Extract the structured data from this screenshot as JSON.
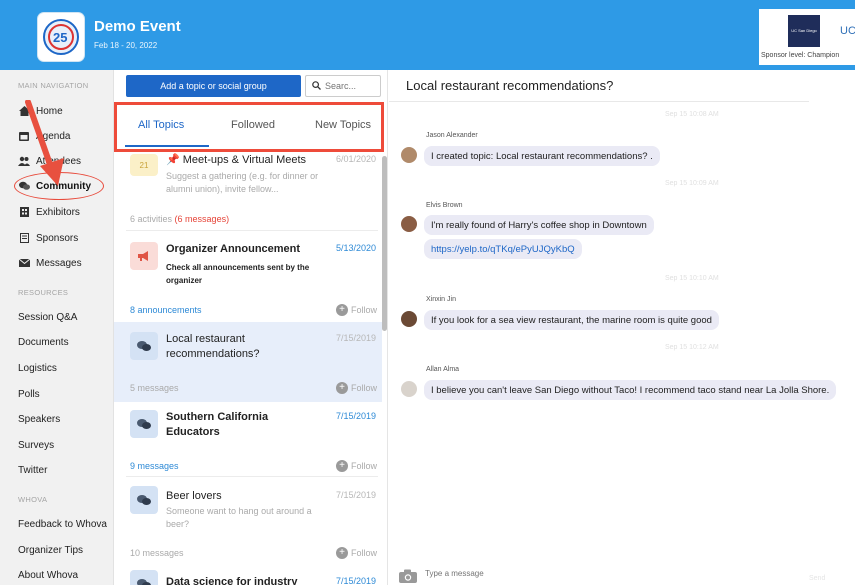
{
  "header": {
    "event_title": "Demo Event",
    "event_dates": "Feb 18 - 20, 2022",
    "sponsor_logo_text": "UC San Diego",
    "sponsor_abbr": "UC",
    "sponsor_level": "Sponsor level: Champion"
  },
  "sidebar": {
    "main_nav_title": "MAIN NAVIGATION",
    "main_items": [
      {
        "label": "Home",
        "icon": "home-icon"
      },
      {
        "label": "Agenda",
        "icon": "calendar-icon"
      },
      {
        "label": "Attendees",
        "icon": "people-icon"
      },
      {
        "label": "Community",
        "icon": "community-icon"
      },
      {
        "label": "Exhibitors",
        "icon": "building-icon"
      },
      {
        "label": "Sponsors",
        "icon": "sponsor-icon"
      },
      {
        "label": "Messages",
        "icon": "envelope-icon"
      }
    ],
    "active_item": "Community",
    "resources_title": "RESOURCES",
    "resource_items": [
      "Session Q&A",
      "Documents",
      "Logistics",
      "Polls",
      "Speakers",
      "Surveys",
      "Twitter"
    ],
    "whova_title": "WHOVA",
    "whova_items": [
      "Feedback to Whova",
      "Organizer Tips",
      "About Whova"
    ]
  },
  "topics": {
    "add_button": "Add a topic or social group",
    "search_placeholder": "Searc...",
    "tabs": [
      "All Topics",
      "Followed",
      "New Topics"
    ],
    "active_tab": "All Topics",
    "follow_label": "Follow",
    "items": [
      {
        "title": "Meet-ups & Virtual Meets",
        "date": "6/01/2020",
        "desc": "Suggest a gathering (e.g. for dinner or alumni union), invite fellow...",
        "meta": "6 activities",
        "meta_extra": "(6 messages)",
        "icon": "pin-icon"
      },
      {
        "title": "Organizer Announcement",
        "date": "5/13/2020",
        "desc": "Check all announcements sent by the organizer",
        "meta": "8 announcements",
        "icon": "megaphone-icon"
      },
      {
        "title": "Local restaurant recommendations?",
        "date": "7/15/2019",
        "meta": "5 messages",
        "icon": "chat-icon"
      },
      {
        "title": "Southern California Educators",
        "date": "7/15/2019",
        "meta": "9 messages",
        "icon": "chat-icon"
      },
      {
        "title": "Beer lovers",
        "date": "7/15/2019",
        "desc": "Someone want to hang out around a beer?",
        "meta": "10 messages",
        "icon": "chat-icon"
      },
      {
        "title": "Data science for industry",
        "date": "7/15/2019",
        "icon": "chat-icon"
      }
    ]
  },
  "chat": {
    "title": "Local restaurant recommendations?",
    "messages": [
      {
        "timestamp": "Sep 15 10:08 AM",
        "sender": "Jason Alexander",
        "text": "I created topic: Local restaurant recommendations? ."
      },
      {
        "timestamp": "Sep 15 10:09 AM",
        "sender": "Elvis Brown",
        "text": "I'm really found of Harry's coffee shop in Downtown",
        "link": "https://yelp.to/qTKq/ePyUJQyKbQ"
      },
      {
        "timestamp": "Sep 15 10:10 AM",
        "sender": "Xinxin Jin",
        "text": "If you look for a sea view restaurant, the marine room is quite good"
      },
      {
        "timestamp": "Sep 15 10:12 AM",
        "sender": "Allan Alma",
        "text": "I believe you can't leave San Diego without Taco! I recommend taco stand near La Jolla Shore."
      }
    ],
    "composer_placeholder": "Type a message",
    "composer_right": "Send"
  },
  "colors": {
    "header_bg": "#2e9ae6",
    "accent": "#1e67c7",
    "annotation_red": "#ee4b3a",
    "selected_row": "#e7eefa"
  }
}
